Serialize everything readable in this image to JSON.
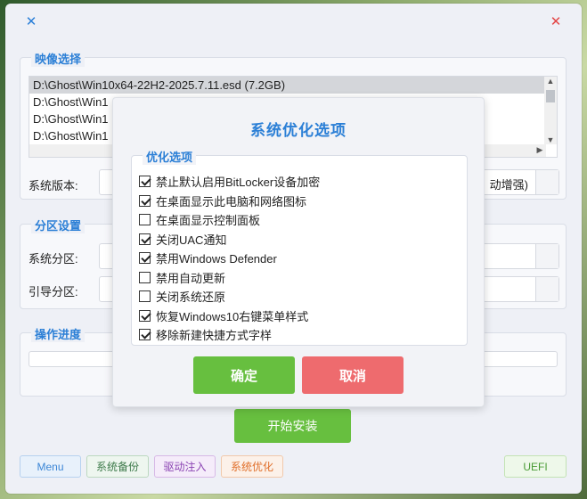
{
  "titlebar": {
    "left_icon": "close-icon-blue",
    "right_icon": "close-icon-red"
  },
  "image_select": {
    "title": "映像选择",
    "list": [
      "D:\\Ghost\\Win10x64-22H2-2025.7.11.esd (7.2GB)",
      "D:\\Ghost\\Win1",
      "D:\\Ghost\\Win1",
      "D:\\Ghost\\Win1"
    ],
    "version_label": "系统版本:",
    "version_value": "动增强)"
  },
  "partition": {
    "title": "分区设置",
    "system_label": "系统分区:",
    "boot_label": "引导分区:"
  },
  "progress": {
    "title": "操作进度",
    "value": 0
  },
  "start_button": "开始安装",
  "bottom": {
    "menu": "Menu",
    "backup": "系统备份",
    "driver": "驱动注入",
    "optimize": "系统优化",
    "uefi": "UEFI"
  },
  "dialog": {
    "title": "系统优化选项",
    "group_title": "优化选项",
    "options": [
      {
        "label": "禁止默认启用BitLocker设备加密",
        "checked": true
      },
      {
        "label": "在桌面显示此电脑和网络图标",
        "checked": true
      },
      {
        "label": "在桌面显示控制面板",
        "checked": false
      },
      {
        "label": "关闭UAC通知",
        "checked": true
      },
      {
        "label": "禁用Windows Defender",
        "checked": true
      },
      {
        "label": "禁用自动更新",
        "checked": false
      },
      {
        "label": "关闭系统还原",
        "checked": false
      },
      {
        "label": "恢复Windows10右键菜单样式",
        "checked": true
      },
      {
        "label": "移除新建快捷方式字样",
        "checked": true
      }
    ],
    "ok": "确定",
    "cancel": "取消"
  },
  "colors": {
    "accent": "#2b7fd6",
    "ok": "#67bf3f",
    "cancel": "#ee6b6e"
  }
}
